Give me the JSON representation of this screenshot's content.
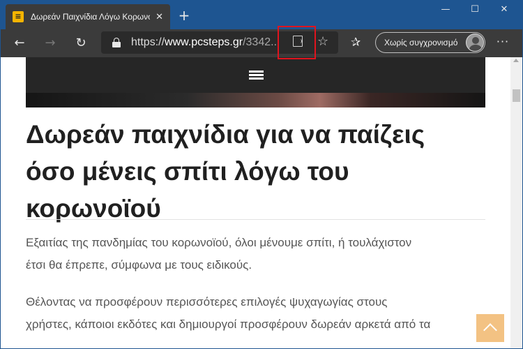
{
  "window": {
    "minimize_glyph": "—",
    "maximize_glyph": "☐",
    "close_glyph": "✕"
  },
  "tab": {
    "title": "Δωρεάν Παιχνίδια Λόγω Κορωνοϊού",
    "favicon_letter": "≡",
    "close_glyph": "✕",
    "favicon_color": "#f5b400"
  },
  "new_tab_glyph": "+",
  "toolbar": {
    "back_glyph": "←",
    "forward_glyph": "→",
    "refresh_glyph": "↻",
    "url_protocol": "https://",
    "url_host": "www.pcsteps.gr",
    "url_path": "/3342...",
    "favorite_glyph": "☆",
    "favorites_list_glyph": "✰",
    "sync_label": "Χωρίς συγχρονισμό",
    "more_glyph": "···",
    "highlight_color": "#e0141e"
  },
  "article": {
    "title": "Δωρεάν παιχνίδια για να παίζεις όσο μένεις σπίτι λόγω του κορωνοϊού",
    "paragraph1_line1": "Εξαιτίας της πανδημίας του κορωνοϊού, όλοι μένουμε σπίτι, ή τουλάχιστον",
    "paragraph1_line2": "έτσι θα έπρεπε, σύμφωνα με τους ειδικούς.",
    "paragraph2_line1": "Θέλοντας να προσφέρουν περισσότερες επιλογές ψυχαγωγίας στους",
    "paragraph2_line2": "χρήστες, κάποιοι εκδότες και δημιουργοί προσφέρουν δωρεάν αρκετά από τα"
  },
  "icons": {
    "tab_icon": "pcsteps-favicon",
    "lock": "lock-icon",
    "read_aloud": "read-aloud-icon",
    "menu": "hamburger-menu-icon",
    "back_to_top": "chevron-up-icon"
  },
  "colors": {
    "titlebar": "#1e5591",
    "toolbar": "#3b3b3b",
    "nav_bar": "#262626",
    "back_to_top": "#f3c283"
  }
}
